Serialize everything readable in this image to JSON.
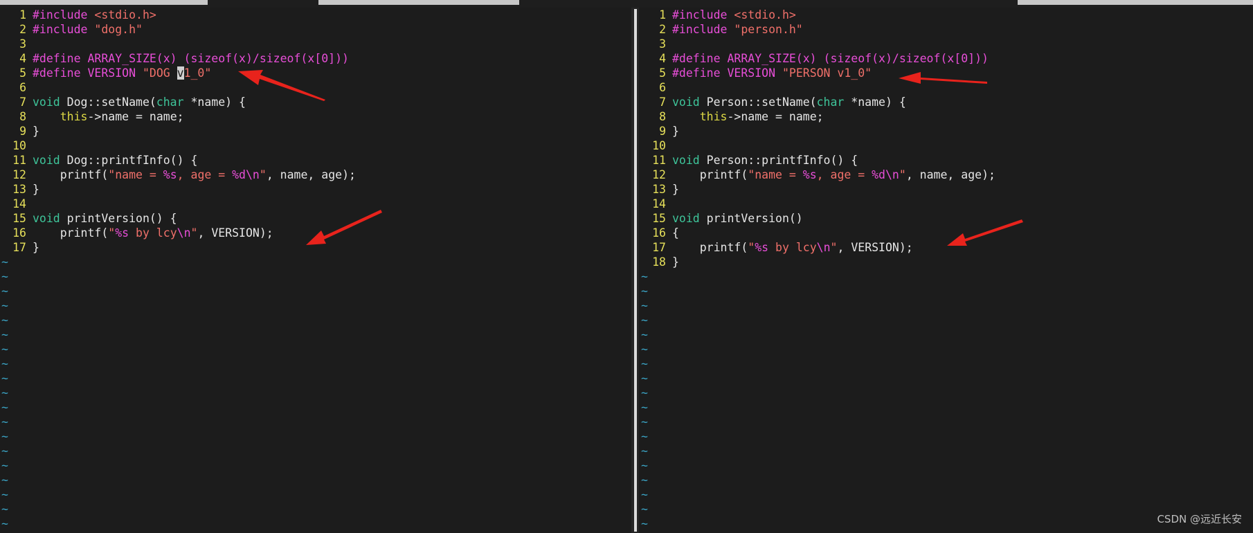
{
  "left_pane": {
    "lines": [
      {
        "n": "1",
        "segs": [
          {
            "t": "#include ",
            "c": "pre"
          },
          {
            "t": "<stdio.h>",
            "c": "str"
          }
        ]
      },
      {
        "n": "2",
        "segs": [
          {
            "t": "#include ",
            "c": "pre"
          },
          {
            "t": "\"dog.h\"",
            "c": "str"
          }
        ]
      },
      {
        "n": "3",
        "segs": []
      },
      {
        "n": "4",
        "segs": [
          {
            "t": "#define ARRAY_SIZE(x) (sizeof(x)/sizeof(x[0]))",
            "c": "pre"
          }
        ]
      },
      {
        "n": "5",
        "segs": [
          {
            "t": "#define VERSION ",
            "c": "pre"
          },
          {
            "t": "\"DOG ",
            "c": "str"
          },
          {
            "t": "v",
            "c": "cursor"
          },
          {
            "t": "1_0\"",
            "c": "str"
          }
        ]
      },
      {
        "n": "6",
        "segs": []
      },
      {
        "n": "7",
        "segs": [
          {
            "t": "void ",
            "c": "kw"
          },
          {
            "t": "Dog::setName(",
            "c": "plain"
          },
          {
            "t": "char",
            "c": "kw"
          },
          {
            "t": " *name) {",
            "c": "plain"
          }
        ]
      },
      {
        "n": "8",
        "segs": [
          {
            "t": "    ",
            "c": "plain"
          },
          {
            "t": "this",
            "c": "kw2"
          },
          {
            "t": "->name = name;",
            "c": "plain"
          }
        ]
      },
      {
        "n": "9",
        "segs": [
          {
            "t": "}",
            "c": "plain"
          }
        ]
      },
      {
        "n": "10",
        "segs": []
      },
      {
        "n": "11",
        "segs": [
          {
            "t": "void ",
            "c": "kw"
          },
          {
            "t": "Dog::printfInfo() {",
            "c": "plain"
          }
        ]
      },
      {
        "n": "12",
        "segs": [
          {
            "t": "    printf(",
            "c": "plain"
          },
          {
            "t": "\"name = ",
            "c": "str"
          },
          {
            "t": "%s",
            "c": "fmt"
          },
          {
            "t": ", age = ",
            "c": "str"
          },
          {
            "t": "%d\\n",
            "c": "fmt"
          },
          {
            "t": "\"",
            "c": "str"
          },
          {
            "t": ", name, age);",
            "c": "plain"
          }
        ]
      },
      {
        "n": "13",
        "segs": [
          {
            "t": "}",
            "c": "plain"
          }
        ]
      },
      {
        "n": "14",
        "segs": []
      },
      {
        "n": "15",
        "segs": [
          {
            "t": "void ",
            "c": "kw"
          },
          {
            "t": "printVersion() {",
            "c": "plain"
          }
        ]
      },
      {
        "n": "16",
        "segs": [
          {
            "t": "    printf(",
            "c": "plain"
          },
          {
            "t": "\"",
            "c": "str"
          },
          {
            "t": "%s",
            "c": "fmt"
          },
          {
            "t": " by lcy",
            "c": "str"
          },
          {
            "t": "\\n",
            "c": "fmt"
          },
          {
            "t": "\"",
            "c": "str"
          },
          {
            "t": ", VERSION);",
            "c": "plain"
          }
        ]
      },
      {
        "n": "17",
        "segs": [
          {
            "t": "}",
            "c": "plain"
          }
        ]
      }
    ],
    "tilde": "~"
  },
  "right_pane": {
    "lines": [
      {
        "n": "1",
        "segs": [
          {
            "t": "#include ",
            "c": "pre"
          },
          {
            "t": "<stdio.h>",
            "c": "str"
          }
        ]
      },
      {
        "n": "2",
        "segs": [
          {
            "t": "#include ",
            "c": "pre"
          },
          {
            "t": "\"person.h\"",
            "c": "str"
          }
        ]
      },
      {
        "n": "3",
        "segs": []
      },
      {
        "n": "4",
        "segs": [
          {
            "t": "#define ARRAY_SIZE(x) (sizeof(x)/sizeof(x[0]))",
            "c": "pre"
          }
        ]
      },
      {
        "n": "5",
        "segs": [
          {
            "t": "#define VERSION ",
            "c": "pre"
          },
          {
            "t": "\"PERSON v1_0\"",
            "c": "str"
          }
        ]
      },
      {
        "n": "6",
        "segs": []
      },
      {
        "n": "7",
        "segs": [
          {
            "t": "void ",
            "c": "kw"
          },
          {
            "t": "Person::setName(",
            "c": "plain"
          },
          {
            "t": "char",
            "c": "kw"
          },
          {
            "t": " *name) {",
            "c": "plain"
          }
        ]
      },
      {
        "n": "8",
        "segs": [
          {
            "t": "    ",
            "c": "plain"
          },
          {
            "t": "this",
            "c": "kw2"
          },
          {
            "t": "->name = name;",
            "c": "plain"
          }
        ]
      },
      {
        "n": "9",
        "segs": [
          {
            "t": "}",
            "c": "plain"
          }
        ]
      },
      {
        "n": "10",
        "segs": []
      },
      {
        "n": "11",
        "segs": [
          {
            "t": "void ",
            "c": "kw"
          },
          {
            "t": "Person::printfInfo() {",
            "c": "plain"
          }
        ]
      },
      {
        "n": "12",
        "segs": [
          {
            "t": "    printf(",
            "c": "plain"
          },
          {
            "t": "\"name = ",
            "c": "str"
          },
          {
            "t": "%s",
            "c": "fmt"
          },
          {
            "t": ", age = ",
            "c": "str"
          },
          {
            "t": "%d\\n",
            "c": "fmt"
          },
          {
            "t": "\"",
            "c": "str"
          },
          {
            "t": ", name, age);",
            "c": "plain"
          }
        ]
      },
      {
        "n": "13",
        "segs": [
          {
            "t": "}",
            "c": "plain"
          }
        ]
      },
      {
        "n": "14",
        "segs": []
      },
      {
        "n": "15",
        "segs": [
          {
            "t": "void ",
            "c": "kw"
          },
          {
            "t": "printVersion()",
            "c": "plain"
          }
        ]
      },
      {
        "n": "16",
        "segs": [
          {
            "t": "{",
            "c": "plain"
          }
        ]
      },
      {
        "n": "17",
        "segs": [
          {
            "t": "    printf(",
            "c": "plain"
          },
          {
            "t": "\"",
            "c": "str"
          },
          {
            "t": "%s",
            "c": "fmt"
          },
          {
            "t": " by lcy",
            "c": "str"
          },
          {
            "t": "\\n",
            "c": "fmt"
          },
          {
            "t": "\"",
            "c": "str"
          },
          {
            "t": ", VERSION);",
            "c": "plain"
          }
        ]
      },
      {
        "n": "18",
        "segs": [
          {
            "t": "}",
            "c": "plain"
          }
        ]
      }
    ],
    "tilde": "~"
  },
  "watermark": "CSDN @远近长安",
  "colors": {
    "background": "#1c1c1c",
    "line_number": "#e6e05a",
    "preprocessor": "#e84ed8",
    "string": "#f0706a",
    "keyword": "#3ec59a",
    "this_keyword": "#dcd845",
    "tilde": "#3aa3c4",
    "annotation_arrow": "#e8231c"
  }
}
